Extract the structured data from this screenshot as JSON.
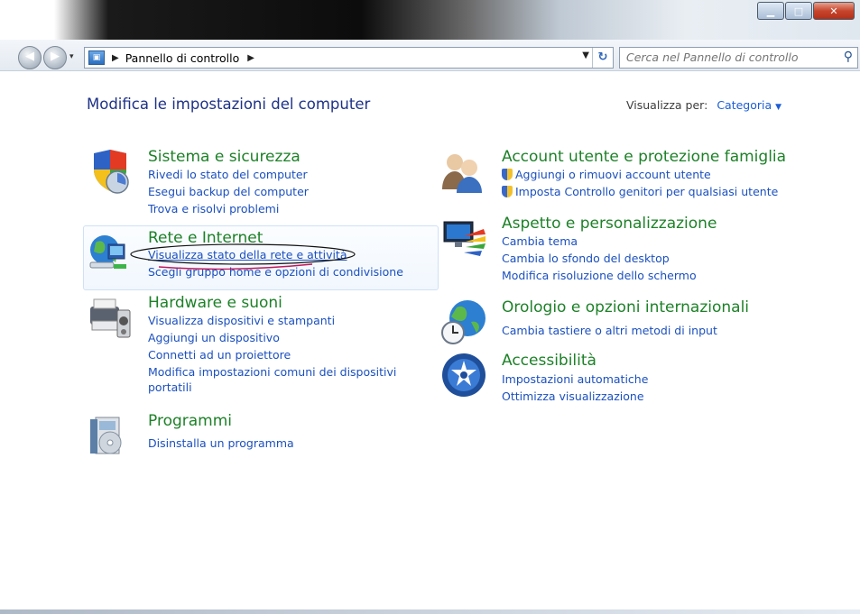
{
  "window": {
    "minimize_label": "▁",
    "maximize_label": "□",
    "close_label": "✕"
  },
  "address": {
    "back_glyph": "◀",
    "forward_glyph": "▶",
    "breadcrumb": "Pannello di controllo",
    "search_placeholder": "Cerca nel Pannello di controllo"
  },
  "page": {
    "title": "Modifica le impostazioni del computer",
    "view_by_label": "Visualizza per:",
    "view_by_value": "Categoria"
  },
  "left": [
    {
      "title": "Sistema e sicurezza",
      "icon": "shield-icon",
      "links": [
        "Rivedi lo stato del computer",
        "Esegui backup del computer",
        "Trova e risolvi problemi"
      ]
    },
    {
      "title": "Rete e Internet",
      "icon": "network-globe-icon",
      "links": [
        "Visualizza stato della rete e attività",
        "Scegli gruppo home e opzioni di condivisione"
      ]
    },
    {
      "title": "Hardware e suoni",
      "icon": "printer-icon",
      "links": [
        "Visualizza dispositivi e stampanti",
        "Aggiungi un dispositivo",
        "Connetti ad un proiettore",
        "Modifica impostazioni comuni dei dispositivi",
        "portatili"
      ]
    },
    {
      "title": "Programmi",
      "icon": "programs-box-icon",
      "links": [
        "Disinstalla un programma"
      ]
    }
  ],
  "right": [
    {
      "title": "Account utente e protezione famiglia",
      "icon": "users-icon",
      "links": [
        "Aggiungi o rimuovi account utente",
        "Imposta Controllo genitori per qualsiasi utente"
      ]
    },
    {
      "title": "Aspetto e personalizzazione",
      "icon": "monitor-palette-icon",
      "links": [
        "Cambia tema",
        "Cambia lo sfondo del desktop",
        "Modifica risoluzione dello schermo"
      ]
    },
    {
      "title": "Orologio e opzioni internazionali",
      "icon": "globe-clock-icon",
      "links": [
        "Cambia tastiere o altri metodi di input"
      ]
    },
    {
      "title": "Accessibilità",
      "icon": "accessibility-icon",
      "links": [
        "Impostazioni automatiche",
        "Ottimizza visualizzazione"
      ]
    }
  ]
}
